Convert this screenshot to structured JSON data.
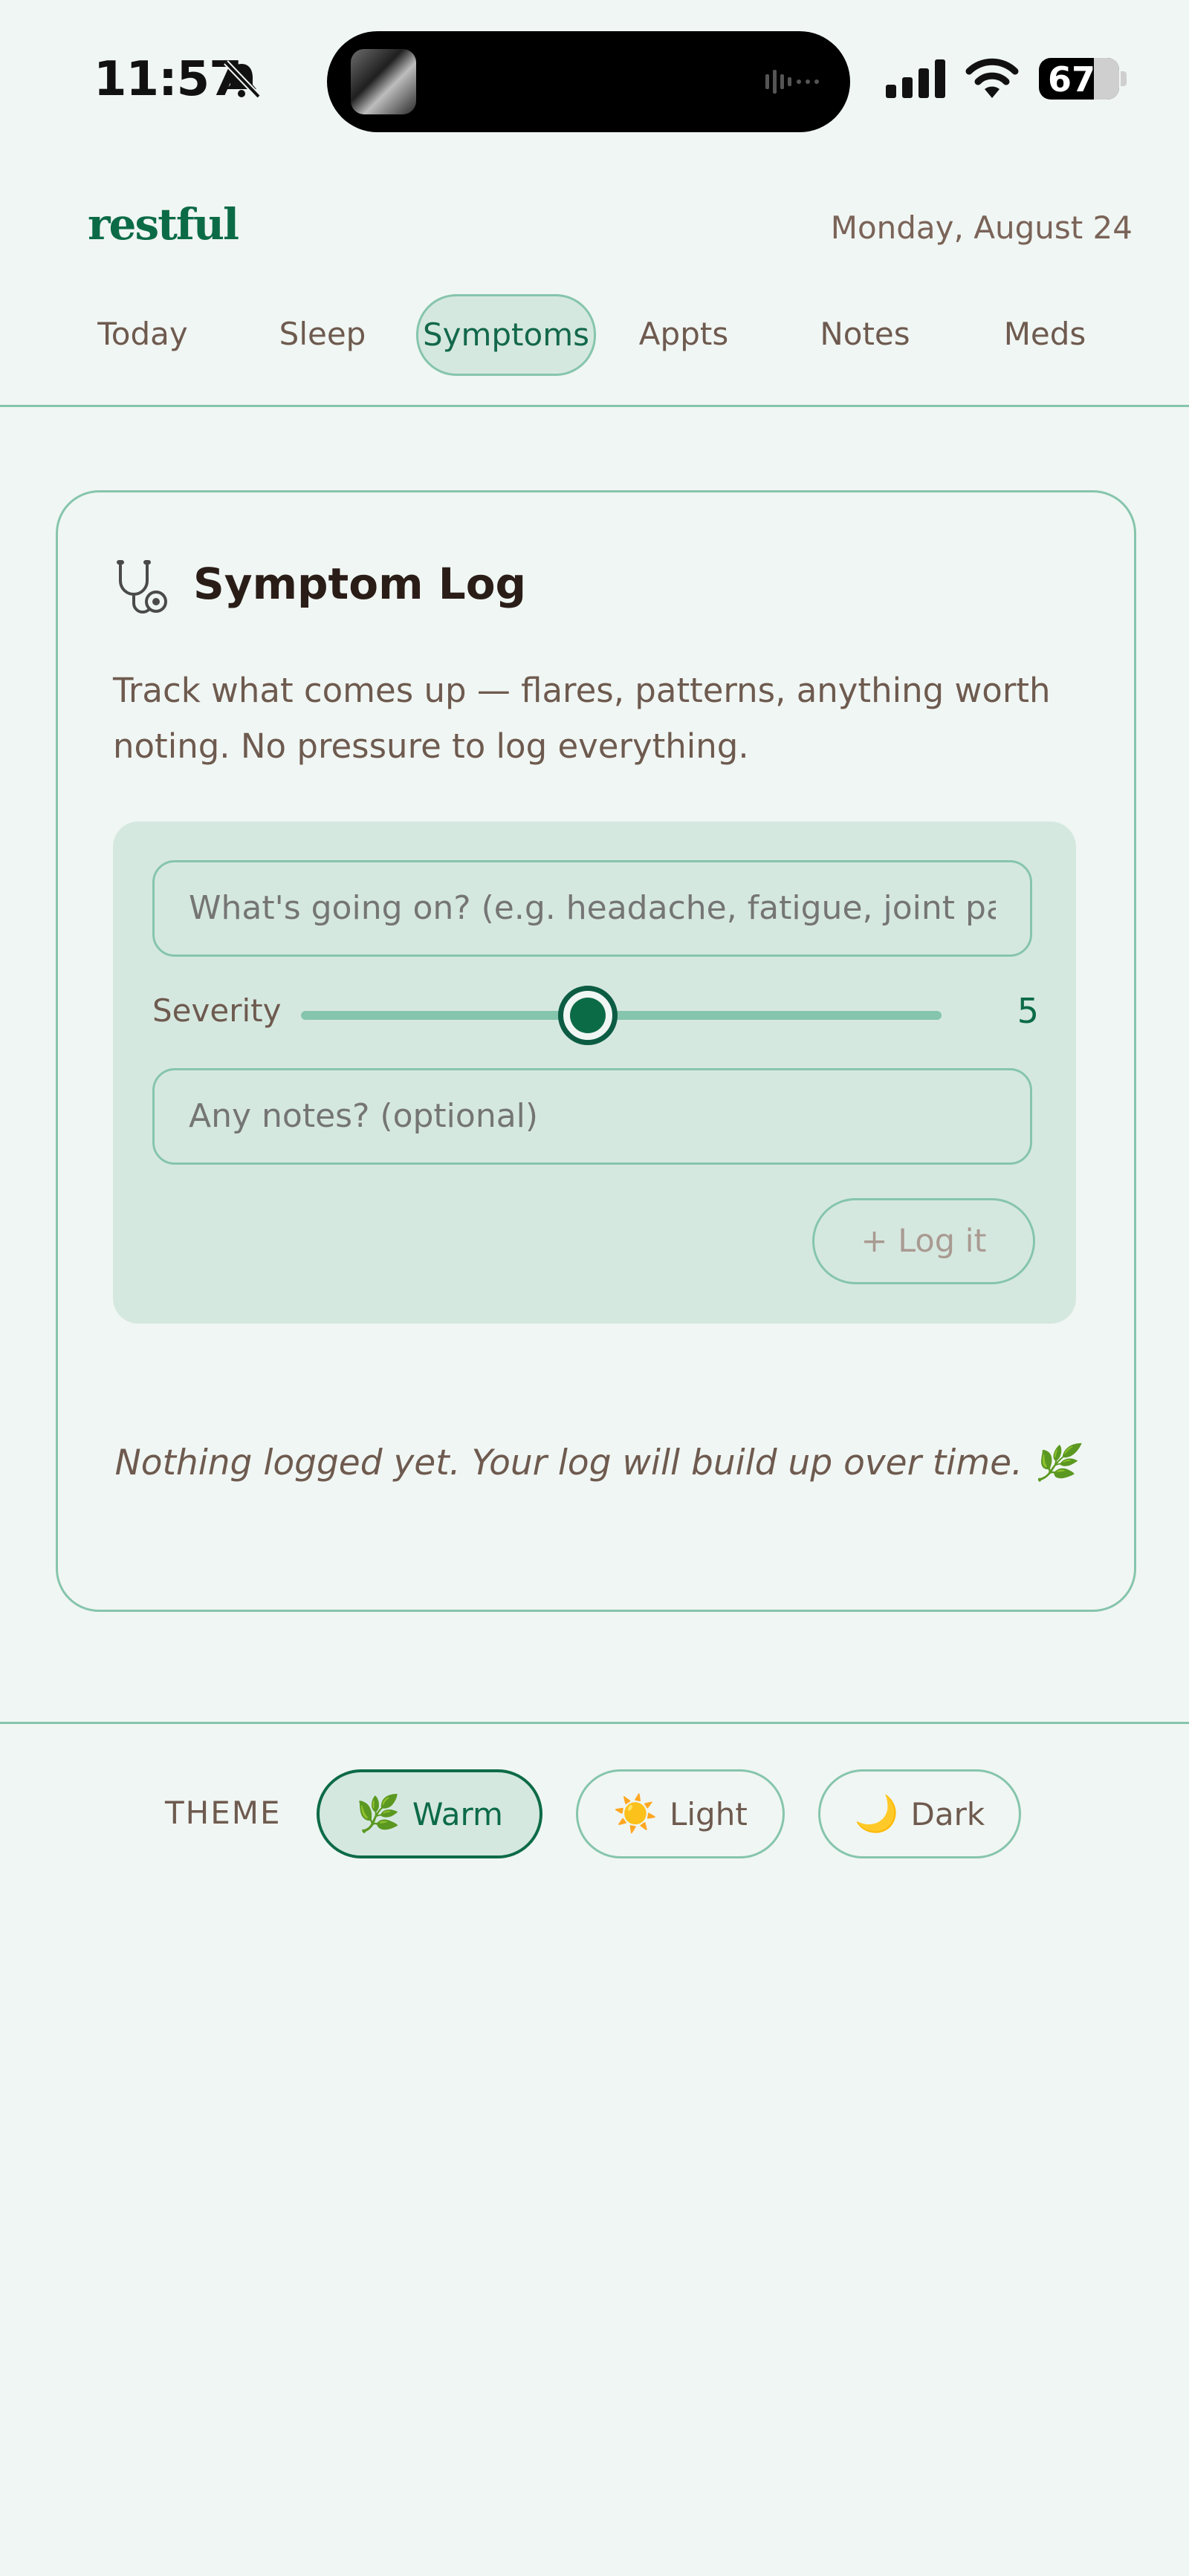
{
  "status_bar": {
    "time": "11:57",
    "battery": "67"
  },
  "header": {
    "brand": "restful",
    "date": "Monday, August 24"
  },
  "tabs": [
    {
      "label": "Today"
    },
    {
      "label": "Sleep"
    },
    {
      "label": "Symptoms",
      "active": true
    },
    {
      "label": "Appts"
    },
    {
      "label": "Notes"
    },
    {
      "label": "Meds"
    }
  ],
  "symptom_log": {
    "title": "Symptom Log",
    "description": "Track what comes up — flares, patterns, anything worth noting. No pressure to log everything.",
    "symptom_placeholder": "What's going on? (e.g. headache, fatigue, joint pai",
    "severity_label": "Severity",
    "severity_value": "5",
    "notes_placeholder": "Any notes? (optional)",
    "log_button": "+ Log it",
    "empty_state": "Nothing logged yet. Your log will build up over time. 🌿"
  },
  "theme": {
    "label": "THEME",
    "options": [
      {
        "label": "Warm",
        "icon": "🌿",
        "active": true
      },
      {
        "label": "Light",
        "icon": "☀️"
      },
      {
        "label": "Dark",
        "icon": "🌙"
      }
    ]
  },
  "colors": {
    "accent": "#0c6b47",
    "border": "#86c5ad",
    "panel": "#d5e8e0",
    "background": "#f0f6f3"
  }
}
